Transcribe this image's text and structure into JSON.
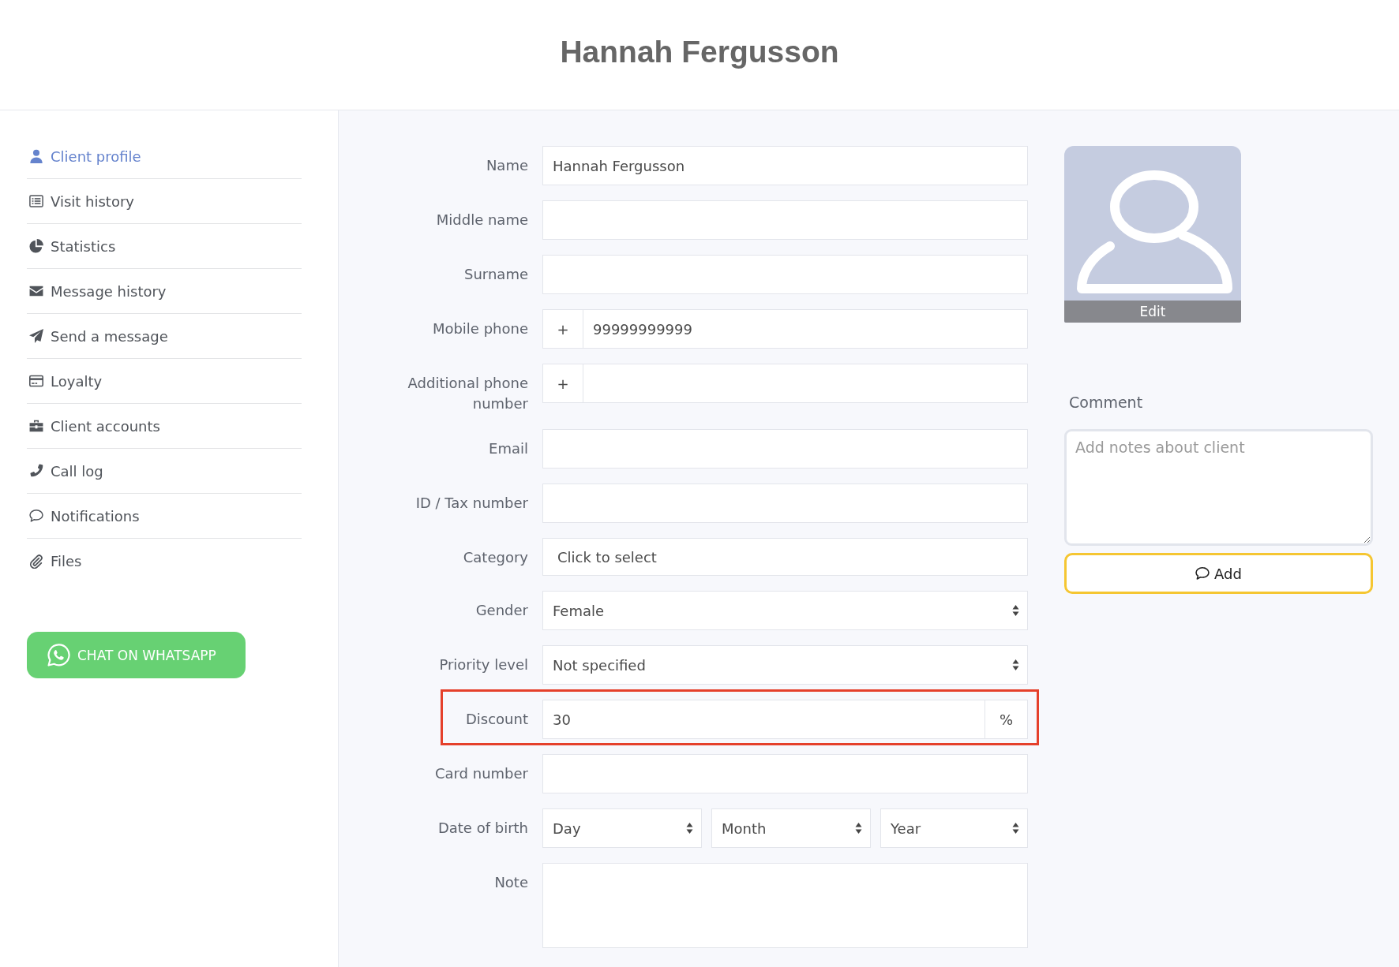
{
  "header": {
    "title": "Hannah Fergusson"
  },
  "sidebar": {
    "items": [
      {
        "label": "Client profile",
        "selected": true
      },
      {
        "label": "Visit history",
        "selected": false
      },
      {
        "label": "Statistics",
        "selected": false
      },
      {
        "label": "Message history",
        "selected": false
      },
      {
        "label": "Send a message",
        "selected": false
      },
      {
        "label": "Loyalty",
        "selected": false
      },
      {
        "label": "Client accounts",
        "selected": false
      },
      {
        "label": "Call log",
        "selected": false
      },
      {
        "label": "Notifications",
        "selected": false
      },
      {
        "label": "Files",
        "selected": false
      }
    ],
    "whatsapp_button": "CHAT ON WHATSAPP"
  },
  "form": {
    "fields": [
      {
        "label": "Name",
        "kind": "text",
        "value": "Hannah Fergusson",
        "highlighted": false
      },
      {
        "label": "Middle name",
        "kind": "text",
        "highlighted": false
      },
      {
        "label": "Surname",
        "kind": "text",
        "highlighted": false
      },
      {
        "label": "Mobile phone",
        "kind": "phone",
        "prefix": "+",
        "value": "99999999999",
        "highlighted": false
      },
      {
        "label": "Additional phone number",
        "kind": "phone",
        "prefix": "+",
        "highlighted": false
      },
      {
        "label": "Email",
        "kind": "text",
        "highlighted": false
      },
      {
        "label": "ID / Tax number",
        "kind": "text",
        "highlighted": false
      },
      {
        "label": "Category",
        "kind": "picker",
        "value": "Click to select",
        "highlighted": false
      },
      {
        "label": "Gender",
        "kind": "select",
        "value": "Female",
        "highlighted": false
      },
      {
        "label": "Priority level",
        "kind": "select",
        "value": "Not specified",
        "highlighted": false
      },
      {
        "label": "Discount",
        "kind": "suffix",
        "value": "30",
        "suffix": "%",
        "highlighted": true
      },
      {
        "label": "Card number",
        "kind": "text",
        "highlighted": false
      },
      {
        "label": "Date of birth",
        "kind": "date",
        "selects": [
          {
            "value": "Day"
          },
          {
            "value": "Month"
          },
          {
            "value": "Year"
          }
        ],
        "highlighted": false
      },
      {
        "label": "Note",
        "kind": "textarea",
        "highlighted": false
      }
    ]
  },
  "avatar": {
    "edit_button": "Edit"
  },
  "comment": {
    "label": "Comment",
    "placeholder": "Add notes about client",
    "button": "Add"
  }
}
